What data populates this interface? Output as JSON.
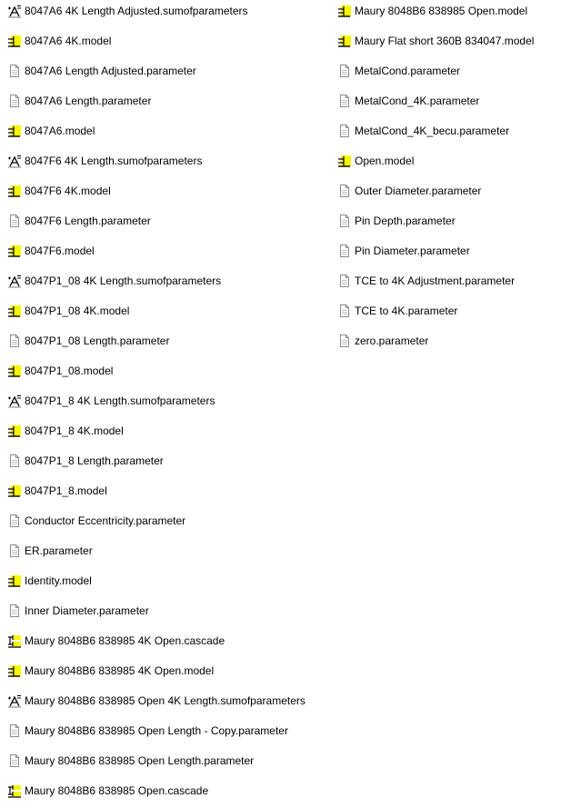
{
  "files": [
    {
      "name": "8047A6 4K Length Adjusted.sumofparameters",
      "icon": "sumofparameters-icon"
    },
    {
      "name": "8047A6 4K.model",
      "icon": "model-icon"
    },
    {
      "name": "8047A6 Length Adjusted.parameter",
      "icon": "document-icon"
    },
    {
      "name": "8047A6 Length.parameter",
      "icon": "document-icon"
    },
    {
      "name": "8047A6.model",
      "icon": "model-icon"
    },
    {
      "name": "8047F6 4K Length.sumofparameters",
      "icon": "sumofparameters-icon"
    },
    {
      "name": "8047F6 4K.model",
      "icon": "model-icon"
    },
    {
      "name": "8047F6 Length.parameter",
      "icon": "document-icon"
    },
    {
      "name": "8047F6.model",
      "icon": "model-icon"
    },
    {
      "name": "8047P1_08 4K Length.sumofparameters",
      "icon": "sumofparameters-icon"
    },
    {
      "name": "8047P1_08 4K.model",
      "icon": "model-icon"
    },
    {
      "name": "8047P1_08 Length.parameter",
      "icon": "document-icon"
    },
    {
      "name": "8047P1_08.model",
      "icon": "model-icon"
    },
    {
      "name": "8047P1_8 4K Length.sumofparameters",
      "icon": "sumofparameters-icon"
    },
    {
      "name": "8047P1_8 4K.model",
      "icon": "model-icon"
    },
    {
      "name": "8047P1_8 Length.parameter",
      "icon": "document-icon"
    },
    {
      "name": "8047P1_8.model",
      "icon": "model-icon"
    },
    {
      "name": "Conductor Eccentricity.parameter",
      "icon": "document-icon"
    },
    {
      "name": "ER.parameter",
      "icon": "document-icon"
    },
    {
      "name": "Identity.model",
      "icon": "model-icon"
    },
    {
      "name": "Inner Diameter.parameter",
      "icon": "document-icon"
    },
    {
      "name": "Maury 8048B6 838985 4K Open.cascade",
      "icon": "cascade-icon"
    },
    {
      "name": "Maury 8048B6 838985 4K Open.model",
      "icon": "model-icon"
    },
    {
      "name": "Maury 8048B6 838985 Open 4K Length.sumofparameters",
      "icon": "sumofparameters-icon"
    },
    {
      "name": "Maury 8048B6 838985 Open Length - Copy.parameter",
      "icon": "document-icon"
    },
    {
      "name": "Maury 8048B6 838985 Open Length.parameter",
      "icon": "document-icon"
    },
    {
      "name": "Maury 8048B6 838985 Open.cascade",
      "icon": "cascade-icon"
    },
    {
      "name": "Maury 8048B6 838985 Open.model",
      "icon": "model-icon"
    },
    {
      "name": "Maury Flat short 360B 834047.model",
      "icon": "model-icon"
    },
    {
      "name": "MetalCond.parameter",
      "icon": "document-icon"
    },
    {
      "name": "MetalCond_4K.parameter",
      "icon": "document-icon"
    },
    {
      "name": "MetalCond_4K_becu.parameter",
      "icon": "document-icon"
    },
    {
      "name": "Open.model",
      "icon": "model-icon"
    },
    {
      "name": "Outer Diameter.parameter",
      "icon": "document-icon"
    },
    {
      "name": "Pin Depth.parameter",
      "icon": "document-icon"
    },
    {
      "name": "Pin Diameter.parameter",
      "icon": "document-icon"
    },
    {
      "name": "TCE to 4K Adjustment.parameter",
      "icon": "document-icon"
    },
    {
      "name": "TCE to 4K.parameter",
      "icon": "document-icon"
    },
    {
      "name": "zero.parameter",
      "icon": "document-icon"
    }
  ],
  "colors": {
    "model_icon_fill": "#f7f700",
    "text": "#000000",
    "background": "#ffffff"
  }
}
